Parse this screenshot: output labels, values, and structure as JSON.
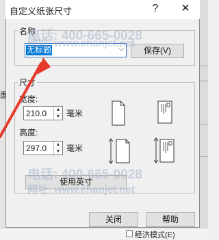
{
  "window": {
    "title": "自定义纸张尺寸",
    "help_glyph": "?",
    "close_glyph": "✕"
  },
  "name_group": {
    "label": "名称",
    "value": "无标题",
    "save_label": "保存(V)"
  },
  "size_group": {
    "label": "尺寸",
    "width_label": "宽度:",
    "width_value": "210.0",
    "height_label": "高度:",
    "height_value": "297.0",
    "unit": "毫米",
    "use_inch_label": "使用英寸"
  },
  "footer": {
    "close_label": "关闭",
    "help_label": "帮助"
  },
  "background": {
    "peek_text": "经济模式(E)",
    "left_peek": "面"
  },
  "watermark": {
    "line1": "电话: 400-665-0028",
    "line2": "网址: www.chanjet.net",
    "line3": "电话: 400-665-0028",
    "line4": "网址: www.chanjet.net"
  },
  "colors": {
    "accent": "#0078d7",
    "arrow": "#e5392b"
  }
}
